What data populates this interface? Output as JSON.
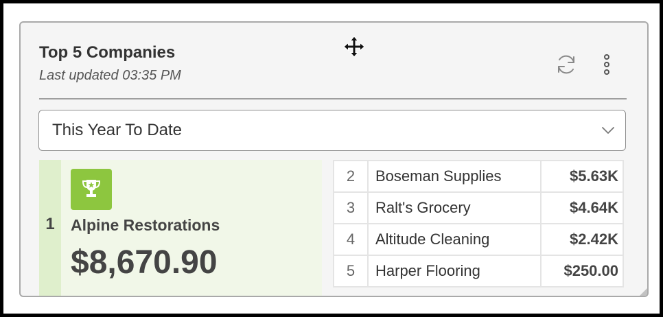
{
  "widget": {
    "title": "Top 5 Companies",
    "subtitle": "Last updated 03:35 PM",
    "icons": [
      "move-icon",
      "refresh-icon",
      "more-vertical-icon",
      "trophy-icon",
      "chevron-down-icon",
      "resize-grip-icon"
    ],
    "accent_color": "#8dc63f"
  },
  "period_select": {
    "value": "This Year To Date"
  },
  "top_company": {
    "rank": "1",
    "name": "Alpine Restorations",
    "amount": "$8,670.90"
  },
  "rankings": [
    {
      "rank": "2",
      "name": "Boseman Supplies",
      "amount": "$5.63K"
    },
    {
      "rank": "3",
      "name": "Ralt's Grocery",
      "amount": "$4.64K"
    },
    {
      "rank": "4",
      "name": "Altitude Cleaning",
      "amount": "$2.42K"
    },
    {
      "rank": "5",
      "name": "Harper Flooring",
      "amount": "$250.00"
    }
  ]
}
